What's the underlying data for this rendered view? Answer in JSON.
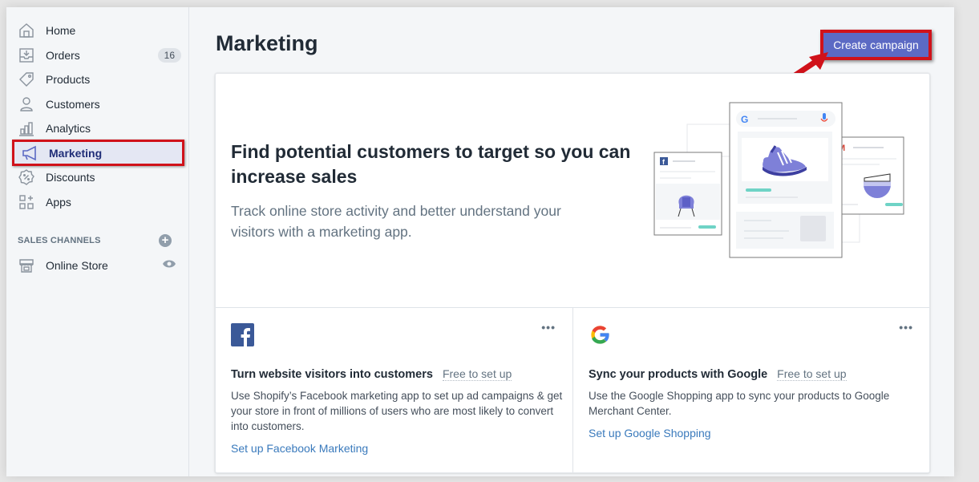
{
  "sidebar": {
    "items": [
      {
        "label": "Home",
        "icon": "home-icon"
      },
      {
        "label": "Orders",
        "icon": "orders-icon",
        "badge": "16"
      },
      {
        "label": "Products",
        "icon": "tag-icon"
      },
      {
        "label": "Customers",
        "icon": "user-icon"
      },
      {
        "label": "Analytics",
        "icon": "bar-chart-icon"
      },
      {
        "label": "Marketing",
        "icon": "megaphone-icon",
        "active": true
      },
      {
        "label": "Discounts",
        "icon": "discount-icon"
      },
      {
        "label": "Apps",
        "icon": "apps-icon"
      }
    ],
    "sales_channels_title": "SALES CHANNELS",
    "channels": [
      {
        "label": "Online Store",
        "icon": "store-icon"
      }
    ]
  },
  "header": {
    "title": "Marketing",
    "create_button": "Create campaign"
  },
  "hero": {
    "heading": "Find potential customers to target so you can increase sales",
    "subtext": "Track online store activity and better understand your visitors with a marketing app."
  },
  "apps": [
    {
      "logo": "facebook-logo",
      "title": "Turn website visitors into customers",
      "price": "Free to set up",
      "description": "Use Shopify’s Facebook marketing app to set up ad campaigns & get your store in front of millions of users who are most likely to convert into customers.",
      "link": "Set up Facebook Marketing"
    },
    {
      "logo": "google-logo",
      "title": "Sync your products with Google",
      "price": "Free to set up",
      "description": "Use the Google Shopping app to sync your products to Google Merchant Center.",
      "link": "Set up Google Shopping"
    }
  ],
  "colors": {
    "primary": "#5c6ac4",
    "highlight": "#d0121a",
    "link": "#3a7abc",
    "accent_teal": "#6fd3c6",
    "illustration_purple": "#7e80d8"
  }
}
